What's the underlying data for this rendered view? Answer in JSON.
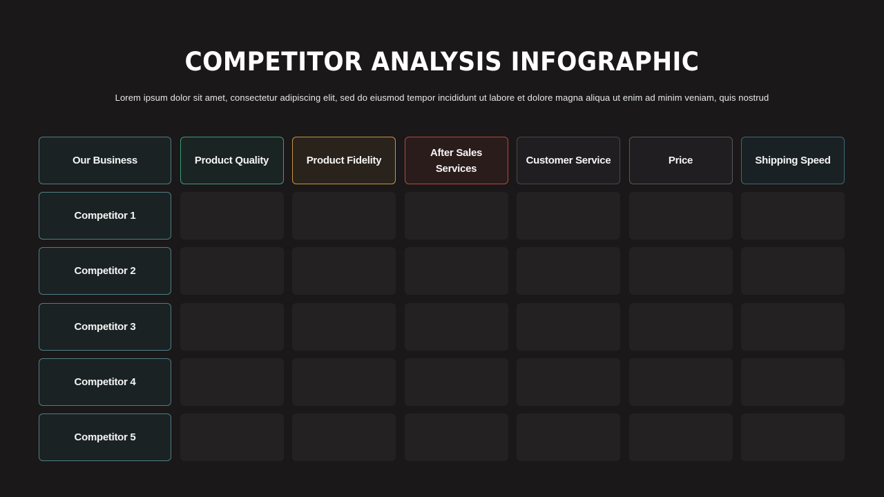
{
  "title": "COMPETITOR ANALYSIS INFOGRAPHIC",
  "subtitle": "Lorem ipsum dolor sit amet, consectetur adipiscing  elit, sed do eiusmod tempor incididunt ut labore et dolore magna  aliqua ut enim ad minim veniam, quis nostrud",
  "table": {
    "corner_label": "Our Business",
    "columns": [
      {
        "label": "Product Quality",
        "color": "#3e9c7c"
      },
      {
        "label": "Product Fidelity",
        "color": "#c8963e"
      },
      {
        "label": "After Sales Services",
        "color": "#b24a43"
      },
      {
        "label": "Customer Service",
        "color": "#4a474a"
      },
      {
        "label": "Price",
        "color": "#5a5758"
      },
      {
        "label": "Shipping Speed",
        "color": "#3d6b79"
      }
    ],
    "rows": [
      {
        "label": "Competitor 1",
        "values": [
          "",
          "",
          "",
          "",
          "",
          ""
        ]
      },
      {
        "label": "Competitor 2",
        "values": [
          "",
          "",
          "",
          "",
          "",
          ""
        ]
      },
      {
        "label": "Competitor 3",
        "values": [
          "",
          "",
          "",
          "",
          "",
          ""
        ]
      },
      {
        "label": "Competitor 4",
        "values": [
          "",
          "",
          "",
          "",
          "",
          ""
        ]
      },
      {
        "label": "Competitor 5",
        "values": [
          "",
          "",
          "",
          "",
          "",
          ""
        ]
      }
    ],
    "row_header_color": "#4f7f86"
  }
}
